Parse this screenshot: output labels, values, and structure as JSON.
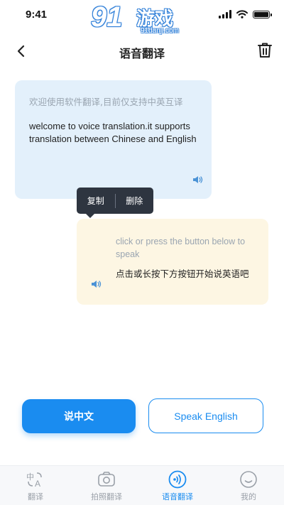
{
  "status_bar": {
    "time": "9:41"
  },
  "watermark": {
    "logo": "91",
    "brand": "游戏",
    "url": "91danji.com"
  },
  "nav": {
    "title": "语音翻译"
  },
  "messages": [
    {
      "source": "欢迎使用软件翻译,目前仅支持中英互译",
      "translation": "welcome to voice translation.it supports translation between Chinese and English"
    },
    {
      "source": "click or press the button below to speak",
      "translation": "点击或长按下方按钮开始说英语吧"
    }
  ],
  "context_menu": {
    "copy": "复制",
    "delete": "删除"
  },
  "buttons": {
    "speak_chinese": "说中文",
    "speak_english": "Speak English"
  },
  "tabs": [
    {
      "label": "翻译",
      "icon": "text-translate-icon"
    },
    {
      "label": "拍照翻译",
      "icon": "camera-icon"
    },
    {
      "label": "语音翻译",
      "icon": "voice-icon",
      "active": true
    },
    {
      "label": "我的",
      "icon": "smiley-icon"
    }
  ],
  "colors": {
    "accent": "#1a8cf0",
    "bubble_left": "#e3f0fb",
    "bubble_right": "#fdf6e3",
    "menu_bg": "#2e3540"
  }
}
